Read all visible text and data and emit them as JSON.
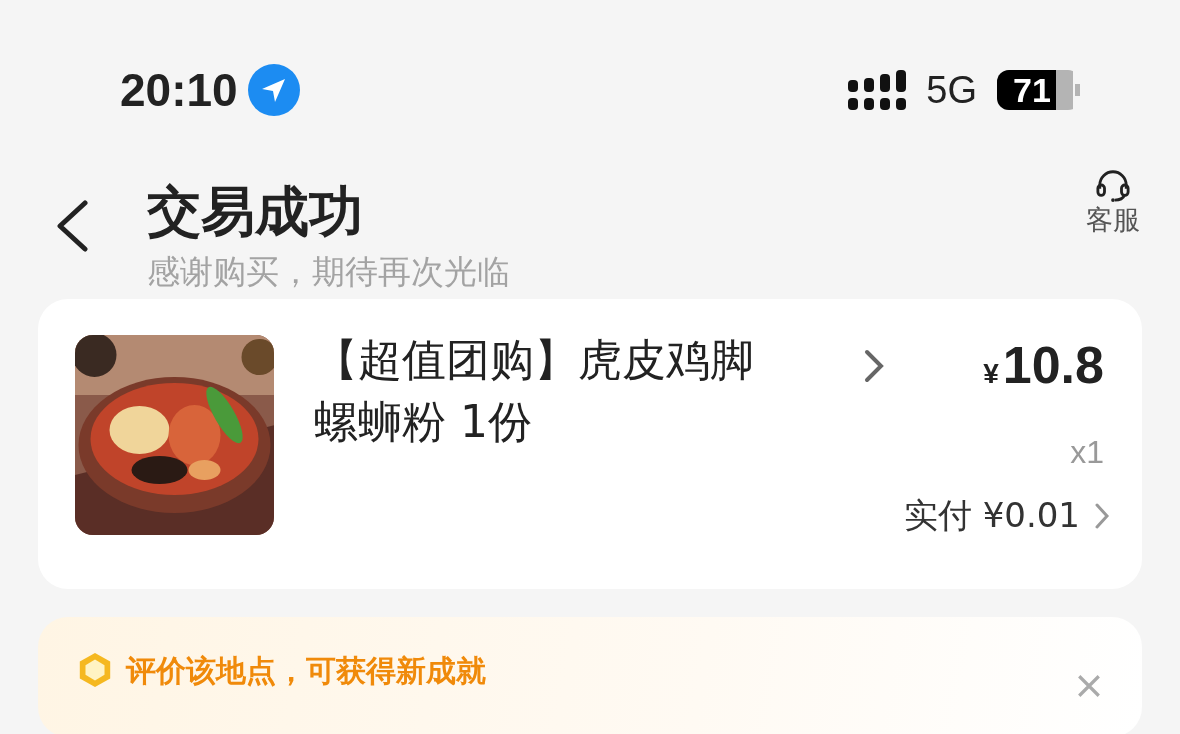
{
  "status_bar": {
    "time": "20:10",
    "network": "5G",
    "battery": {
      "label": "71",
      "level": 0.71
    }
  },
  "header": {
    "title": "交易成功",
    "subtitle": "感谢购买，期待再次光临",
    "service_label": "客服"
  },
  "order": {
    "kind": "picture",
    "title": "【超值团购】虎皮鸡脚螺蛳粉 1份",
    "currency": "¥",
    "price": "10.8",
    "quantity": "x1",
    "paid": "实付 ¥0.01"
  },
  "review_banner": {
    "text": "评价该地点，可获得新成就"
  }
}
